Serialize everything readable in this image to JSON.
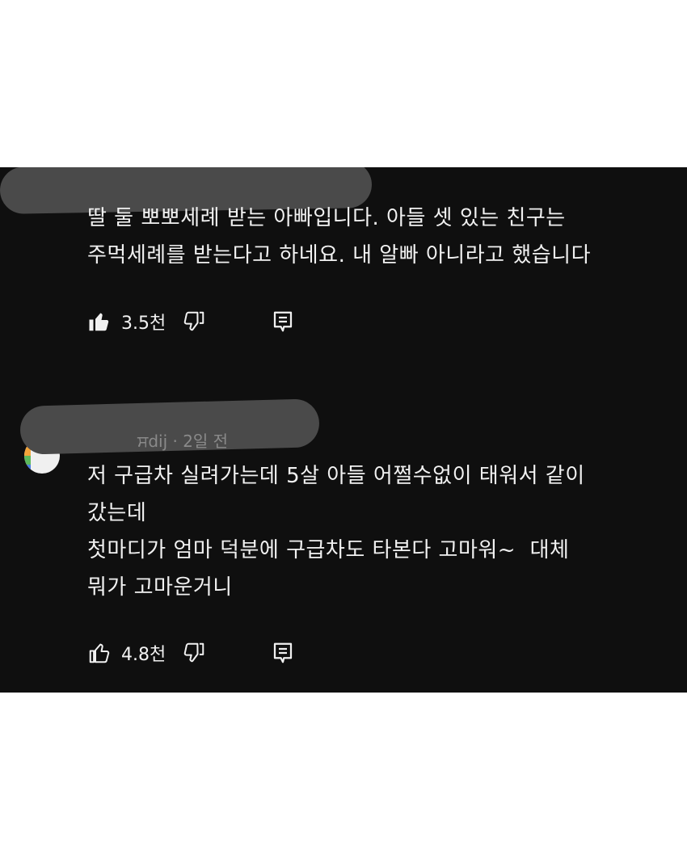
{
  "comments": [
    {
      "meta_peek": "",
      "text": "딸 둘 뽀뽀세례 받는 아빠입니다. 아들 셋 있는 친구는\n주먹세례를 받는다고 하네요. 내 알빠 아니라고 했습니다",
      "likes": "3.5천",
      "liked": true,
      "like_icon": "thumbs-up-filled-icon",
      "dislike_icon": "thumbs-down-outline-icon",
      "reply_icon": "reply-comment-icon"
    },
    {
      "meta_peek": "ਸdij · 2일 전",
      "text": "저 구급차 실려가는데 5살 아들 어쩔수없이 태워서 같이\n갔는데\n첫마디가 엄마 덕분에 구급차도 타본다 고마워~  대체\n뭐가 고마운거니",
      "likes": "4.8천",
      "liked": false,
      "like_icon": "thumbs-up-outline-icon",
      "dislike_icon": "thumbs-down-outline-icon",
      "reply_icon": "reply-comment-icon"
    }
  ],
  "colors": {
    "panel_bg": "#0f0f0f",
    "text": "#f1f1f1",
    "scribble": "#4a4a4a",
    "page_bg": "#ffffff"
  }
}
